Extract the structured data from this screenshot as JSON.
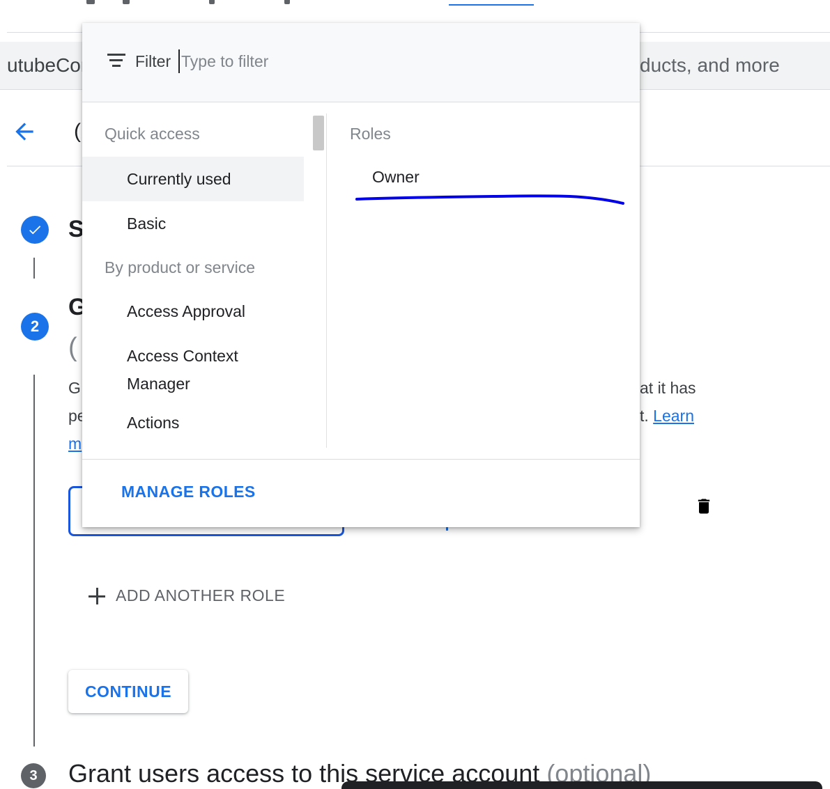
{
  "background": {
    "search_left_fragment": "utubeCor",
    "search_right_fragment": "ducts, and more",
    "page_title_fragment": "(",
    "step1_fragment": "S",
    "step2_number": "2",
    "step2_title_fragment": "G",
    "step2_paren_fragment": "(",
    "desc_line1_left": "G",
    "desc_line1_right": "at it has",
    "desc_line2_left": "pe",
    "desc_line2_right": "t.",
    "learn_label": "Learn",
    "desc_line3_left": "m",
    "add_another_role_label": "ADD ANOTHER ROLE",
    "continue_label": "CONTINUE",
    "step3_number": "3",
    "step3_title": "Grant users access to this service account",
    "step3_optional": "(optional)"
  },
  "dropdown": {
    "filter_label": "Filter",
    "filter_placeholder": "Type to filter",
    "sections": {
      "quick_access": "Quick access",
      "by_product": "By product or service"
    },
    "quick_access_items": [
      "Currently used",
      "Basic"
    ],
    "product_items": [
      "Access Approval",
      "Access Context Manager",
      "Actions"
    ],
    "roles_header": "Roles",
    "roles": [
      "Owner"
    ],
    "manage_roles_label": "MANAGE ROLES"
  },
  "colors": {
    "accent": "#1a73e8",
    "annotation_ink": "#0000e6"
  }
}
